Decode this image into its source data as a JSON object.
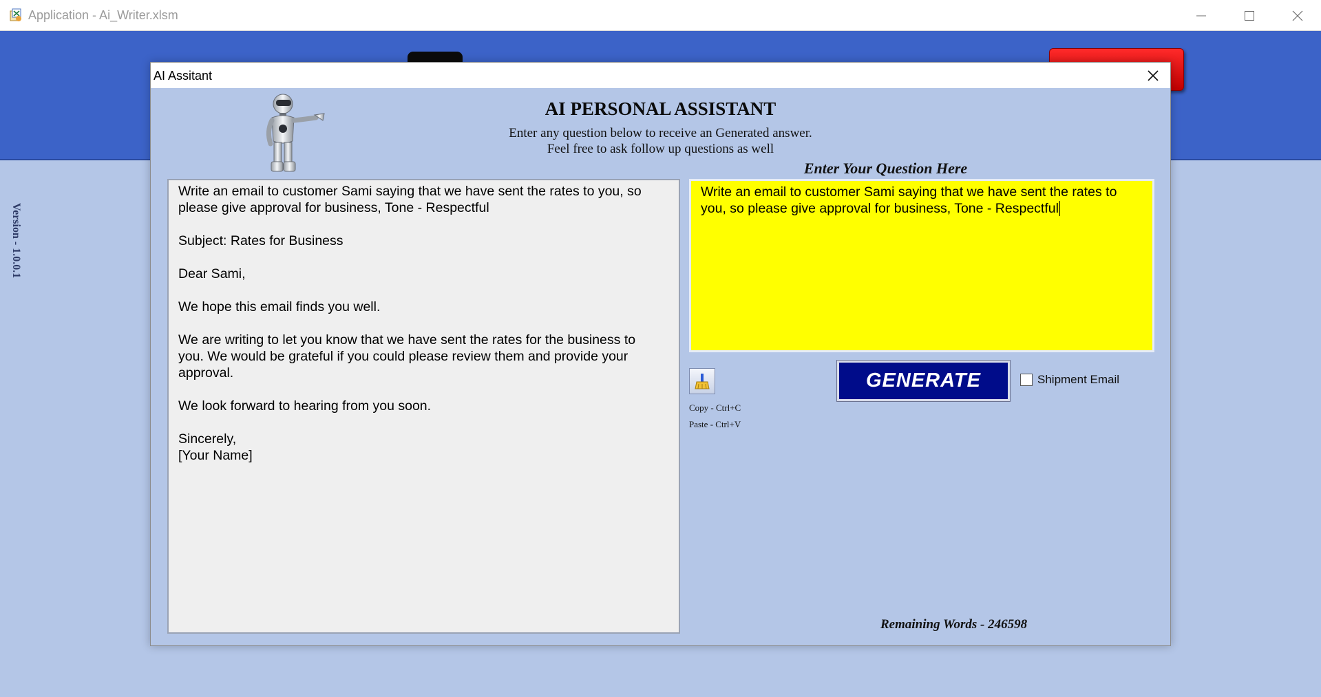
{
  "app": {
    "title": "Application - Ai_Writer.xlsm",
    "icon": "excel-app-icon"
  },
  "window_controls": {
    "minimize_icon": "minimize-icon",
    "maximize_icon": "maximize-icon",
    "close_icon": "close-icon"
  },
  "background": {
    "version_label": "Version - 1.0.0.1",
    "header_color": "#3c63c8"
  },
  "dialog": {
    "title": "AI Assitant",
    "heading": "AI PERSONAL ASSISTANT",
    "subtitle_line1": "Enter any question below to receive an Generated answer.",
    "subtitle_line2": "Feel free to ask follow up questions as well",
    "question_label": "Enter Your Question Here",
    "answer_text": "Write an email to customer Sami saying that we have sent the rates to you, so\nplease give approval for business, Tone - Respectful\n\nSubject: Rates for Business\n\nDear Sami,\n\nWe hope this email finds you well.\n\nWe are writing to let you know that we have sent the rates for the business to\nyou. We would be grateful if you could please review them and provide your\napproval.\n\nWe look forward to hearing from you soon.\n\nSincerely,\n[Your Name]",
    "question_text": "Write an email to customer Sami saying that we have sent the rates to\nyou, so please give approval for business, Tone - Respectful",
    "clear_icon": "broom-clear-icon",
    "hint_copy": "Copy - Ctrl+C",
    "hint_paste": "Paste - Ctrl+V",
    "generate_label": "GENERATE",
    "shipment_label": "Shipment Email",
    "shipment_checked": false,
    "remaining_label": "Remaining Words - 246598",
    "colors": {
      "question_bg": "#ffff00",
      "generate_bg": "#000c8a",
      "dialog_bg": "#b4c6e7"
    }
  }
}
